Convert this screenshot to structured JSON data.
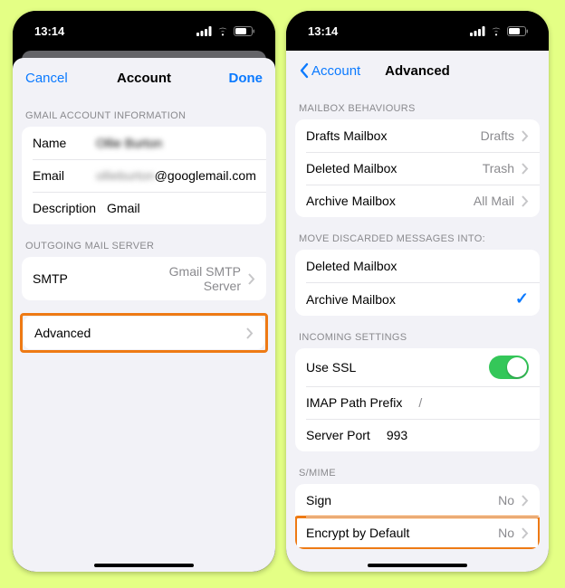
{
  "status": {
    "time": "13:14"
  },
  "left": {
    "nav": {
      "cancel": "Cancel",
      "title": "Account",
      "done": "Done"
    },
    "groups": {
      "info_header": "GMAIL ACCOUNT INFORMATION",
      "name_label": "Name",
      "name_value": "Ollie Burton",
      "email_label": "Email",
      "email_value_blur": "ollieburton",
      "email_domain": "@googlemail.com",
      "description_label": "Description",
      "description_value": "Gmail",
      "outgoing_header": "OUTGOING MAIL SERVER",
      "smtp_label": "SMTP",
      "smtp_value": "Gmail SMTP Server",
      "advanced_label": "Advanced"
    }
  },
  "right": {
    "nav": {
      "back": "Account",
      "title": "Advanced"
    },
    "groups": {
      "mailbox_header": "MAILBOX BEHAVIOURS",
      "drafts_label": "Drafts Mailbox",
      "drafts_value": "Drafts",
      "deleted_label": "Deleted Mailbox",
      "deleted_value": "Trash",
      "archive_label": "Archive Mailbox",
      "archive_value": "All Mail",
      "discarded_header": "MOVE DISCARDED MESSAGES INTO:",
      "discarded_deleted": "Deleted Mailbox",
      "discarded_archive": "Archive Mailbox",
      "incoming_header": "INCOMING SETTINGS",
      "ssl_label": "Use SSL",
      "imap_label": "IMAP Path Prefix",
      "imap_value": "/",
      "port_label": "Server Port",
      "port_value": "993",
      "smime_header": "S/MIME",
      "sign_label": "Sign",
      "sign_value": "No",
      "encrypt_label": "Encrypt by Default",
      "encrypt_value": "No"
    }
  }
}
